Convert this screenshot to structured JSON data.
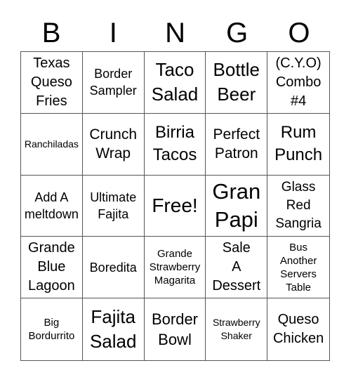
{
  "title_letters": [
    "B",
    "I",
    "N",
    "G",
    "O"
  ],
  "cells": [
    {
      "text": "Texas\nQueso\nFries",
      "size": "s20"
    },
    {
      "text": "Border\nSampler",
      "size": "s18"
    },
    {
      "text": "Taco\nSalad",
      "size": "s26"
    },
    {
      "text": "Bottle\nBeer",
      "size": "s26"
    },
    {
      "text": "(C.Y.O)\nCombo\n#4",
      "size": "s20"
    },
    {
      "text": "Ranchiladas",
      "size": "s14"
    },
    {
      "text": "Crunch\nWrap",
      "size": "s21"
    },
    {
      "text": "Birria\nTacos",
      "size": "s24"
    },
    {
      "text": "Perfect\nPatron",
      "size": "s21"
    },
    {
      "text": "Rum\nPunch",
      "size": "s24"
    },
    {
      "text": "Add A\nmeltdown",
      "size": "s18"
    },
    {
      "text": "Ultimate\nFajita",
      "size": "s18"
    },
    {
      "text": "Free!",
      "size": "s28"
    },
    {
      "text": "Gran\nPapi",
      "size": "s31"
    },
    {
      "text": "Glass\nRed\nSangria",
      "size": "s19"
    },
    {
      "text": "Grande\nBlue\nLagoon",
      "size": "s20"
    },
    {
      "text": "Boredita",
      "size": "s18"
    },
    {
      "text": "Grande\nStrawberry\nMagarita",
      "size": "s15"
    },
    {
      "text": "Sale\nA\nDessert",
      "size": "s20"
    },
    {
      "text": "Bus\nAnother\nServers\nTable",
      "size": "s15"
    },
    {
      "text": "Big\nBordurrito",
      "size": "s15"
    },
    {
      "text": "Fajita\nSalad",
      "size": "s26"
    },
    {
      "text": "Border\nBowl",
      "size": "s22"
    },
    {
      "text": "Strawberry\nShaker",
      "size": "s14"
    },
    {
      "text": "Queso\nChicken",
      "size": "s20"
    }
  ]
}
